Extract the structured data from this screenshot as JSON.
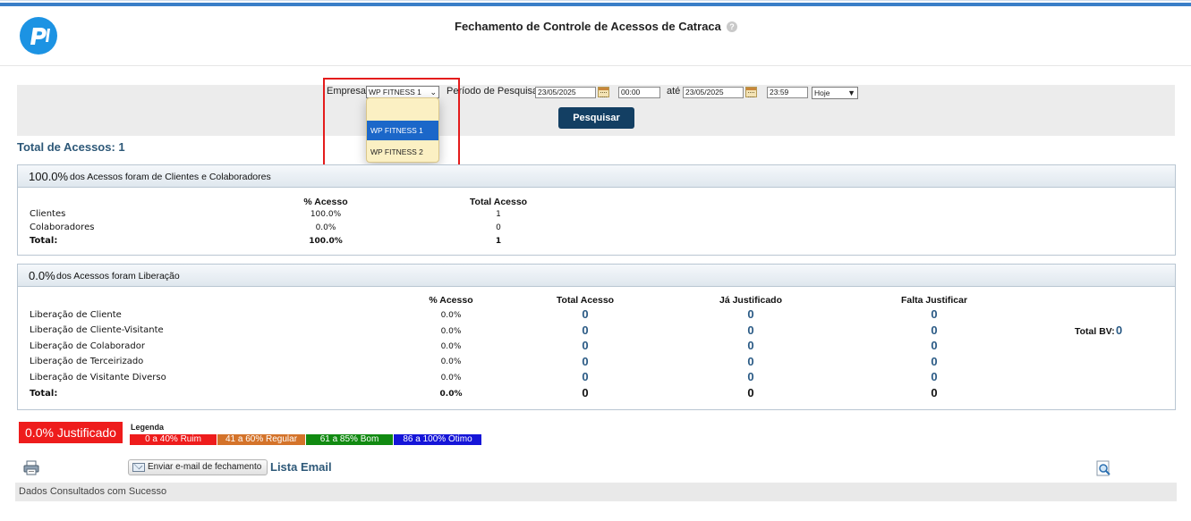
{
  "header": {
    "title": "Fechamento de Controle de Acessos de Catraca",
    "help_icon": "?"
  },
  "filters": {
    "empresa_label": "Empresa:",
    "empresa_value": "WP FITNESS 1",
    "empresa_options": [
      "WP FITNESS 1",
      "WP FITNESS 2"
    ],
    "periodo_label": "Período de Pesquisa:",
    "start_date": "23/05/2025",
    "start_time": "00:00",
    "ate_label": "até",
    "end_date": "23/05/2025",
    "end_time": "23:59",
    "preset_value": "Hoje",
    "search_button": "Pesquisar"
  },
  "total_acessos": "Total de Acessos: 1",
  "clients_section": {
    "pct": "100.0%",
    "title": "dos Acessos foram de Clientes e Colaboradores",
    "headers": [
      "% Acesso",
      "Total Acesso"
    ],
    "rows": [
      {
        "label": "Clientes",
        "pct": "100.0%",
        "total": "1"
      },
      {
        "label": "Colaboradores",
        "pct": "0.0%",
        "total": "0"
      }
    ],
    "total_row": {
      "label": "Total:",
      "pct": "100.0%",
      "total": "1"
    }
  },
  "release_section": {
    "pct": "0.0%",
    "title": "dos Acessos foram Liberação",
    "headers": [
      "% Acesso",
      "Total Acesso",
      "Já Justificado",
      "Falta Justificar"
    ],
    "rows": [
      {
        "label": "Liberação de Cliente",
        "pct": "0.0%",
        "total": "0",
        "justificado": "0",
        "falta": "0"
      },
      {
        "label": "Liberação de Cliente-Visitante",
        "pct": "0.0%",
        "total": "0",
        "justificado": "0",
        "falta": "0"
      },
      {
        "label": "Liberação de Colaborador",
        "pct": "0.0%",
        "total": "0",
        "justificado": "0",
        "falta": "0"
      },
      {
        "label": "Liberação de Terceirizado",
        "pct": "0.0%",
        "total": "0",
        "justificado": "0",
        "falta": "0"
      },
      {
        "label": "Liberação de Visitante Diverso",
        "pct": "0.0%",
        "total": "0",
        "justificado": "0",
        "falta": "0"
      }
    ],
    "total_row": {
      "label": "Total:",
      "pct": "0.0%",
      "total": "0",
      "justificado": "0",
      "falta": "0"
    },
    "total_bv_label": "Total BV:",
    "total_bv_value": "0"
  },
  "justificado_badge": "0.0% Justificado",
  "legend": {
    "title": "Legenda",
    "items": [
      {
        "label": "0 a 40% Ruim",
        "color": "#ee1c1c"
      },
      {
        "label": "41 a 60% Regular",
        "color": "#d4732a"
      },
      {
        "label": "61 a 85% Bom",
        "color": "#118a11"
      },
      {
        "label": "86 a 100% Ótimo",
        "color": "#1515d8"
      }
    ]
  },
  "actions": {
    "email_button": "Enviar e-mail de fechamento",
    "lista_email": "Lista Email"
  },
  "status_text": "Dados Consultados com Sucesso",
  "colors": {
    "accent_dark": "#133f63",
    "link_blue": "#2d5878",
    "highlight_red": "#e41c1c",
    "dropdown_selected": "#1b67c9"
  },
  "icons": [
    "logo",
    "help-icon",
    "calendar-icon",
    "chevron-down-icon",
    "print-icon",
    "envelope-icon",
    "zoom-icon"
  ]
}
